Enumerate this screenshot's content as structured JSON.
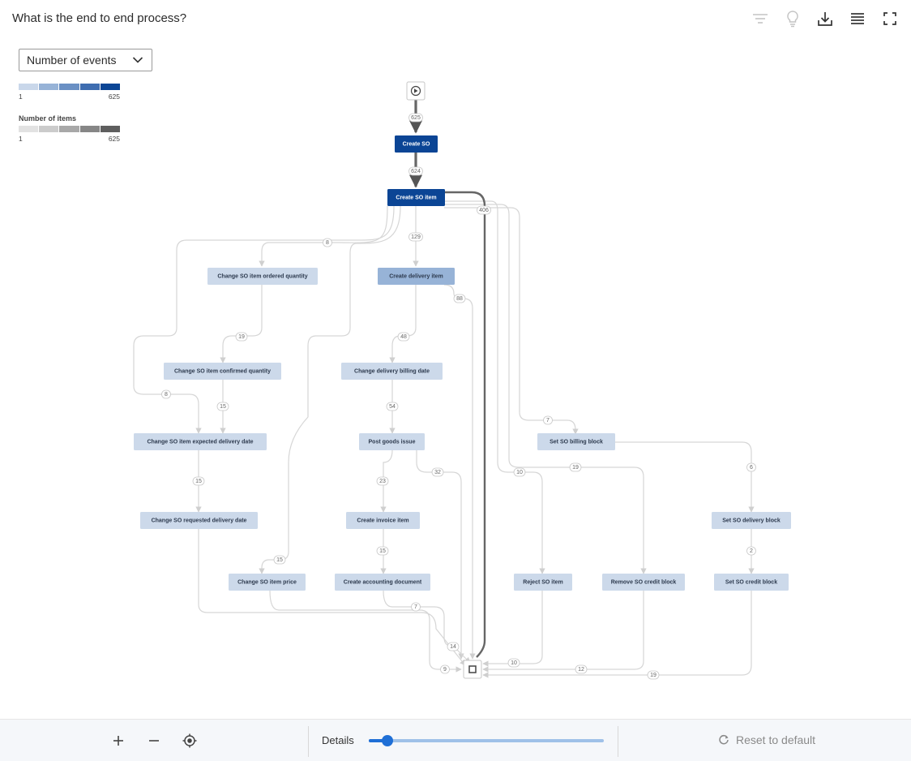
{
  "header": {
    "title": "What is the end to end process?",
    "icons": [
      "filter-icon",
      "lightbulb-icon",
      "download-icon",
      "list-icon",
      "fullscreen-icon"
    ]
  },
  "metric_select": {
    "selected": "Number of events"
  },
  "legend": {
    "events": {
      "min": "1",
      "max": "625",
      "colors": [
        "#c9d7ea",
        "#97b3d7",
        "#6a90c4",
        "#3e6db0",
        "#0b4595"
      ]
    },
    "items": {
      "title": "Number of items",
      "min": "1",
      "max": "625",
      "colors": [
        "#e2e2e2",
        "#cbcbcb",
        "#a8a8a8",
        "#868686",
        "#5e5e5e"
      ]
    }
  },
  "process_map": {
    "start_icon": "play-circle-icon",
    "end_icon": "stop-square-icon",
    "nodes": [
      {
        "id": "create-so",
        "label": "Create SO"
      },
      {
        "id": "create-so-item",
        "label": "Create SO item"
      },
      {
        "id": "change-ordered-qty",
        "label": "Change SO item ordered quantity"
      },
      {
        "id": "create-delivery-item",
        "label": "Create delivery item"
      },
      {
        "id": "change-confirmed-qty",
        "label": "Change SO item confirmed quantity"
      },
      {
        "id": "change-delivery-billing-date",
        "label": "Change delivery billing date"
      },
      {
        "id": "change-expected-delivery",
        "label": "Change SO item expected delivery date"
      },
      {
        "id": "post-goods-issue",
        "label": "Post goods issue"
      },
      {
        "id": "set-billing-block",
        "label": "Set SO billing block"
      },
      {
        "id": "change-requested-delivery",
        "label": "Change SO requested delivery date"
      },
      {
        "id": "create-invoice-item",
        "label": "Create invoice item"
      },
      {
        "id": "set-delivery-block",
        "label": "Set SO delivery block"
      },
      {
        "id": "change-item-price",
        "label": "Change SO item price"
      },
      {
        "id": "create-accounting-doc",
        "label": "Create accounting document"
      },
      {
        "id": "reject-so-item",
        "label": "Reject SO item"
      },
      {
        "id": "remove-credit-block",
        "label": "Remove SO credit block"
      },
      {
        "id": "set-credit-block",
        "label": "Set SO credit block"
      }
    ],
    "edge_labels": [
      "625",
      "624",
      "406",
      "8",
      "129",
      "88",
      "19",
      "48",
      "8",
      "15",
      "54",
      "7",
      "15",
      "32",
      "10",
      "19",
      "6",
      "23",
      "15",
      "2",
      "15",
      "7",
      "14",
      "10",
      "12",
      "9",
      "19"
    ]
  },
  "footer": {
    "details_label": "Details",
    "details_level": 0.08,
    "reset_label": "Reset to default"
  }
}
